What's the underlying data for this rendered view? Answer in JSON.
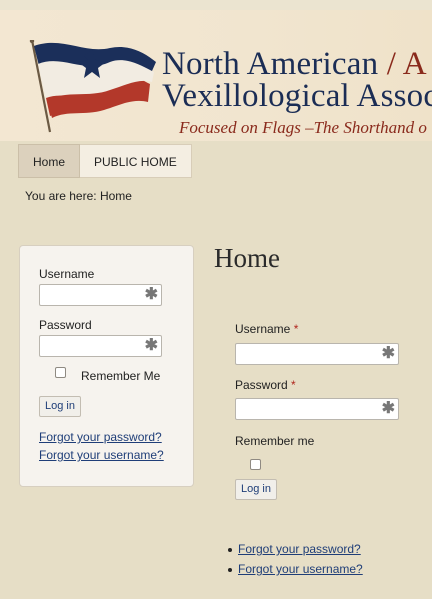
{
  "header": {
    "org_line1": "North American",
    "org_slash": "/ A",
    "org_line2": "Vexillological Associ",
    "tagline": "Focused on Flags –The Shorthand o"
  },
  "nav": {
    "items": [
      {
        "label": "Home"
      },
      {
        "label": "PUBLIC HOME"
      }
    ]
  },
  "breadcrumb": "You are here: Home",
  "side_login": {
    "username_label": "Username",
    "password_label": "Password",
    "remember_label": "Remember Me",
    "login_button": "Log in",
    "forgot_password": "Forgot your password?",
    "forgot_username": "Forgot your username?",
    "required_glyph": "✱"
  },
  "main": {
    "title": "Home",
    "username_label": "Username",
    "password_label": "Password",
    "required_mark": "*",
    "remember_label": "Remember me",
    "login_button": "Log in",
    "links": [
      {
        "label": "Forgot your password?"
      },
      {
        "label": "Forgot your username?"
      }
    ]
  },
  "colors": {
    "background": "#e6dec6",
    "link": "#1f3e78",
    "heading_blue": "#1b2d55",
    "accent_red": "#8a2a1c",
    "required_red": "#b0261d"
  },
  "icons": {
    "flag": "flag-icon",
    "required": "asterisk-icon"
  }
}
